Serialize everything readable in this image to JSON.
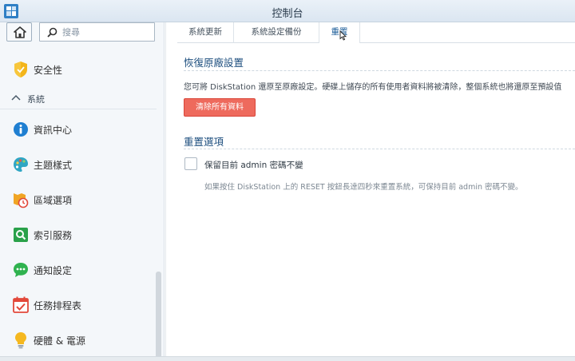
{
  "window": {
    "title": "控制台"
  },
  "sidebar": {
    "search_placeholder": "搜尋",
    "section_label": "系統",
    "items": [
      {
        "label": "安全性",
        "icon": "shield-icon"
      },
      {
        "label": "資訊中心",
        "icon": "info-icon"
      },
      {
        "label": "主題樣式",
        "icon": "palette-icon"
      },
      {
        "label": "區域選項",
        "icon": "regional-clock-icon"
      },
      {
        "label": "索引服務",
        "icon": "index-search-icon"
      },
      {
        "label": "通知設定",
        "icon": "chat-bubble-icon"
      },
      {
        "label": "任務排程表",
        "icon": "calendar-check-icon"
      },
      {
        "label": "硬體 & 電源",
        "icon": "lightbulb-icon"
      }
    ]
  },
  "tabs": [
    {
      "label": "系統更新"
    },
    {
      "label": "系統設定備份"
    },
    {
      "label": "重置",
      "active": true
    }
  ],
  "reset": {
    "title": "恢復原廠設置",
    "description": "您可將 DiskStation 還原至原廠設定。硬碟上儲存的所有使用者資料將被清除，整個系統也將還原至預設值",
    "button_label": "清除所有資料"
  },
  "options": {
    "title": "重置選項",
    "checkbox_label": "保留目前 admin 密碼不變",
    "checkbox_checked": false,
    "hint": "如果按住 DiskStation 上的 RESET 按鈕長達四秒來重置系統，可保持目前 admin 密碼不變。"
  },
  "colors": {
    "accent": "#1e4f7f",
    "danger_button": "#ee6a5d"
  }
}
